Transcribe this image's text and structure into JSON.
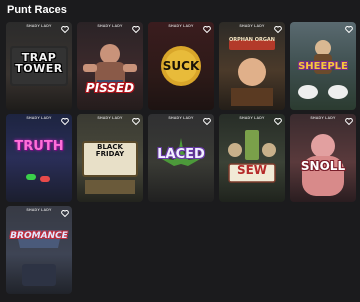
{
  "section": {
    "title": "Punt Races"
  },
  "provider_badge": "SHADY LADY",
  "games": [
    {
      "logo": "TRAP TOWER",
      "badge": "SHADY LADY"
    },
    {
      "logo": "PISSED",
      "badge": "SHADY LADY"
    },
    {
      "logo": "SUCK",
      "badge": "SHADY LADY"
    },
    {
      "logo": "ORPHAN ORGAN",
      "badge": "SHADY LADY"
    },
    {
      "logo": "SHEEPLE",
      "badge": ""
    },
    {
      "logo": "TRUTH",
      "badge": "SHADY LADY"
    },
    {
      "logo": "BLACK FRIDAY",
      "badge": "SHADY LADY"
    },
    {
      "logo": "LACED",
      "badge": "SHADY LADY"
    },
    {
      "logo": "SEW",
      "badge": "SHADY LADY"
    },
    {
      "logo": "SNOLL",
      "badge": "SHADY LADY"
    },
    {
      "logo": "BROMANCE",
      "badge": "SHADY LADY"
    }
  ],
  "icons": {
    "favorite": "heart-outline-icon"
  }
}
